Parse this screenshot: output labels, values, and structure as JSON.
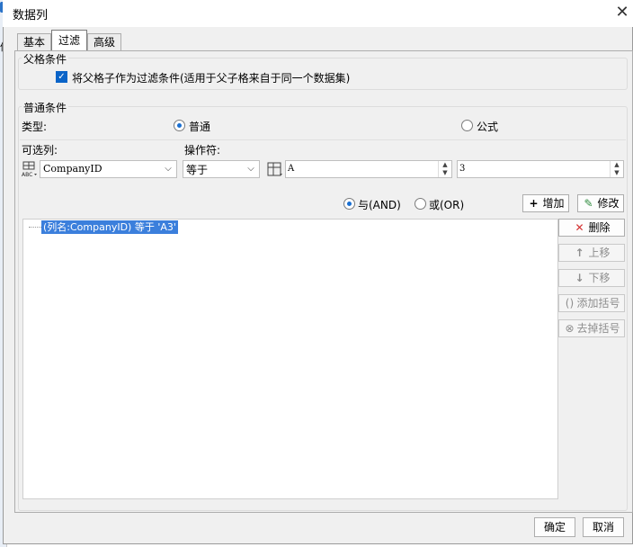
{
  "dialog": {
    "title": "数据列",
    "close_glyph": "✕",
    "tabs": [
      {
        "label": "基本",
        "active": false
      },
      {
        "label": "过滤",
        "active": true
      },
      {
        "label": "高级",
        "active": false
      }
    ]
  },
  "background": {
    "fragment_label": "体"
  },
  "parent_condition": {
    "group_label": "父格条件",
    "checkbox_label": "将父格子作为过滤条件(适用于父子格来自于同一个数据集)",
    "checked": true
  },
  "normal_condition": {
    "group_label": "普通条件",
    "type_label": "类型:",
    "type_options": [
      {
        "label": "普通",
        "selected": true
      },
      {
        "label": "公式",
        "selected": false
      }
    ],
    "column_label": "可选列:",
    "operator_label": "操作符:",
    "column_value": "CompanyID",
    "operator_value": "等于",
    "value_left": "A",
    "value_right": "3",
    "logic_options": [
      {
        "label": "与(AND)",
        "selected": true
      },
      {
        "label": "或(OR)",
        "selected": false
      }
    ],
    "add_label": "增加",
    "modify_label": "修改"
  },
  "condition_tree": {
    "items": [
      "(列名:CompanyID) 等于 'A3'"
    ]
  },
  "side_buttons": [
    {
      "label": "删除",
      "enabled": true,
      "icon": "delete-icon"
    },
    {
      "label": "上移",
      "enabled": false,
      "icon": "arrow-up-icon"
    },
    {
      "label": "下移",
      "enabled": false,
      "icon": "arrow-down-icon"
    },
    {
      "label": "添加括号",
      "enabled": false,
      "icon": "add-bracket-icon"
    },
    {
      "label": "去掉括号",
      "enabled": false,
      "icon": "remove-bracket-icon"
    }
  ],
  "footer": {
    "ok_label": "确定",
    "cancel_label": "取消"
  },
  "colors": {
    "accent": "#0a64c8",
    "selection": "#3b7fdc",
    "delete_red": "#d32f2f",
    "modify_green": "#2e8b3e"
  }
}
